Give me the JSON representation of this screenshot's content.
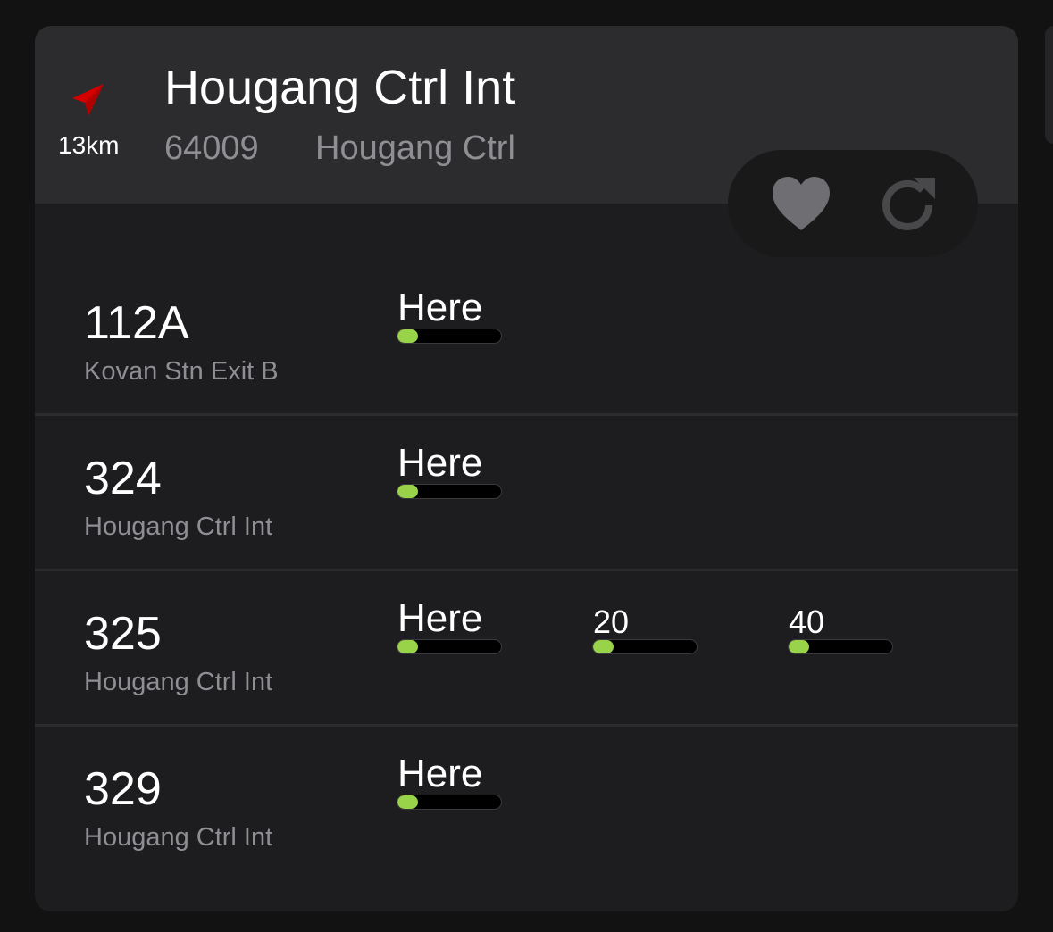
{
  "header": {
    "distance": "13km",
    "stop_name": "Hougang Ctrl Int",
    "stop_code": "64009",
    "road_name": "Hougang Ctrl",
    "icons": {
      "direction": "navigation-arrow-icon",
      "favourite": "heart-icon",
      "refresh": "refresh-icon"
    },
    "colors": {
      "direction_arrow": "#d40000",
      "icon_gray": "#6e6e73"
    }
  },
  "services": [
    {
      "number": "112A",
      "destination": "Kovan Stn Exit B",
      "arrivals": [
        {
          "label": "Here",
          "load": 0.2
        }
      ]
    },
    {
      "number": "324",
      "destination": "Hougang Ctrl Int",
      "arrivals": [
        {
          "label": "Here",
          "load": 0.2
        }
      ]
    },
    {
      "number": "325",
      "destination": "Hougang Ctrl Int",
      "arrivals": [
        {
          "label": "Here",
          "load": 0.2
        },
        {
          "label": "20",
          "load": 0.2
        },
        {
          "label": "40",
          "load": 0.2
        }
      ]
    },
    {
      "number": "329",
      "destination": "Hougang Ctrl Int",
      "arrivals": [
        {
          "label": "Here",
          "load": 0.2
        }
      ]
    }
  ],
  "colors": {
    "load_fill": "#99d34a"
  }
}
